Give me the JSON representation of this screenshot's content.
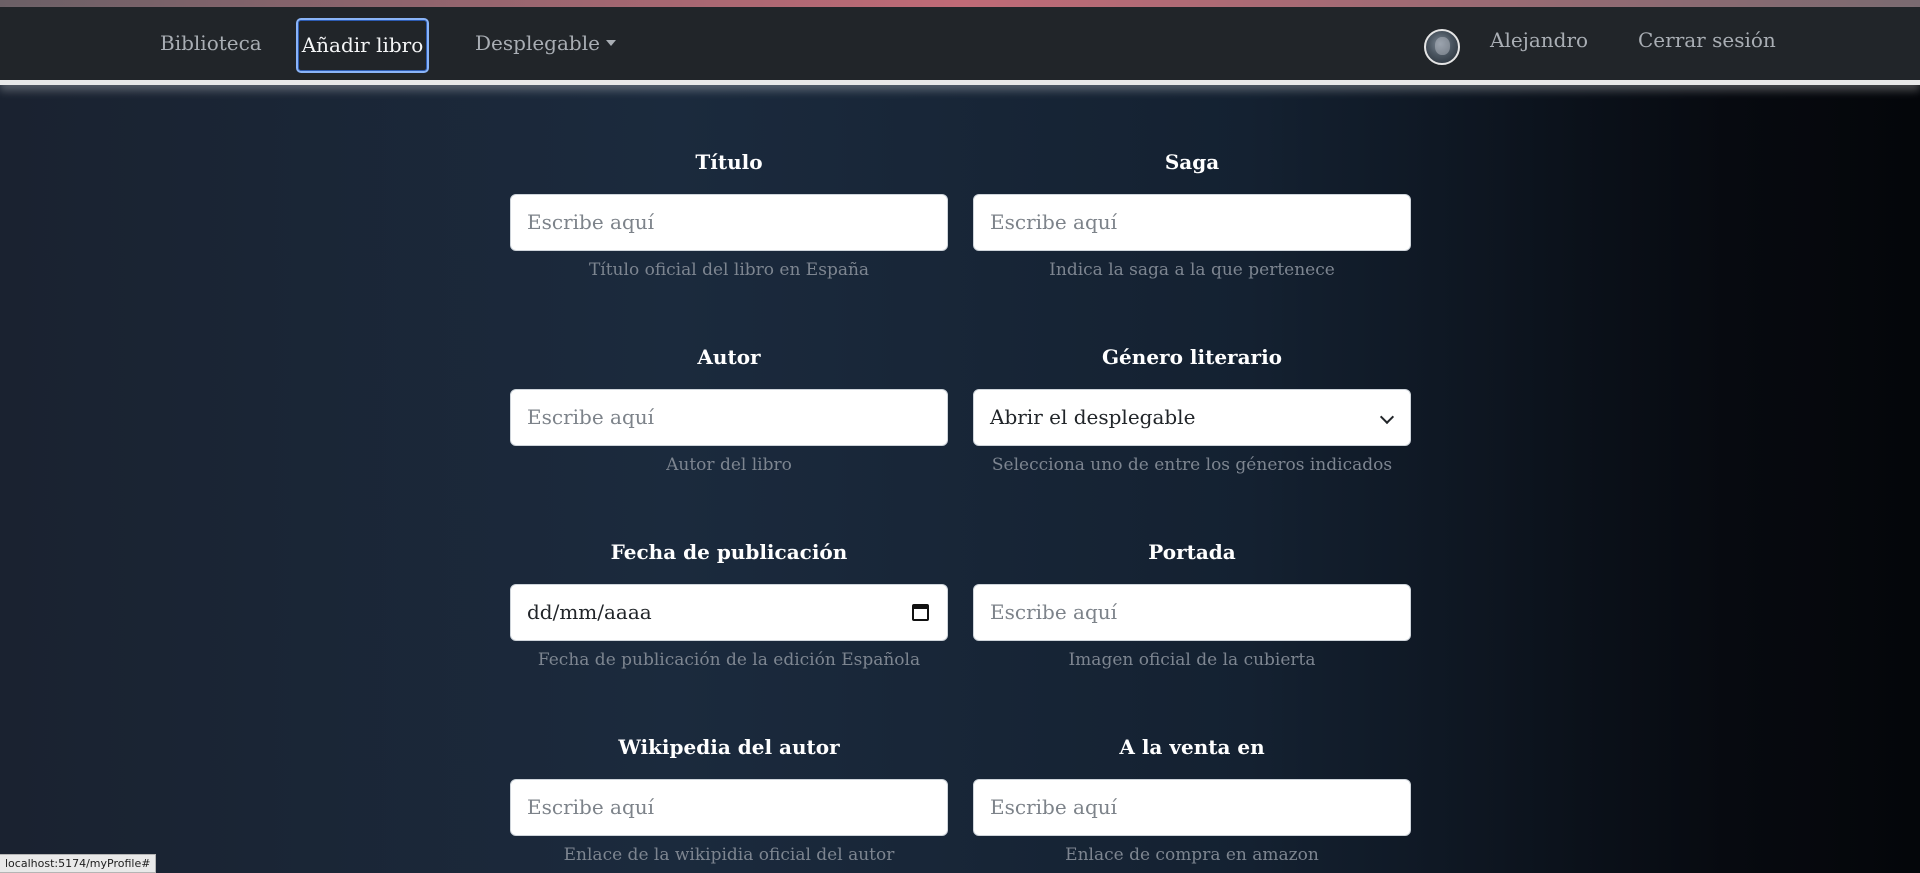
{
  "nav": {
    "biblioteca": "Biblioteca",
    "anadir_libro": "Añadir libro",
    "desplegable": "Desplegable",
    "user_name": "Alejandro",
    "logout": "Cerrar sesión"
  },
  "form": {
    "titulo": {
      "label": "Título",
      "placeholder": "Escribe aquí",
      "help": "Título oficial del libro en España"
    },
    "saga": {
      "label": "Saga",
      "placeholder": "Escribe aquí",
      "help": "Indica la saga a la que pertenece"
    },
    "autor": {
      "label": "Autor",
      "placeholder": "Escribe aquí",
      "help": "Autor del libro"
    },
    "genero": {
      "label": "Género literario",
      "selected": "Abrir el desplegable",
      "help": "Selecciona uno de entre los géneros indicados"
    },
    "fecha": {
      "label": "Fecha de publicación",
      "value": "dd/mm/aaaa",
      "help": "Fecha de publicación de la edición Española"
    },
    "portada": {
      "label": "Portada",
      "placeholder": "Escribe aquí",
      "help": "Imagen oficial de la cubierta"
    },
    "wikipedia": {
      "label": "Wikipedia del autor",
      "placeholder": "Escribe aquí",
      "help": "Enlace de la wikipidia oficial del autor"
    },
    "venta": {
      "label": "A la venta en",
      "placeholder": "Escribe aquí",
      "help": "Enlace de compra en amazon"
    }
  },
  "status_url": "localhost:5174/myProfile#",
  "colors": {
    "navbar": "#212529",
    "active_border": "#8ab4f8",
    "help_text": "#7d8590"
  }
}
